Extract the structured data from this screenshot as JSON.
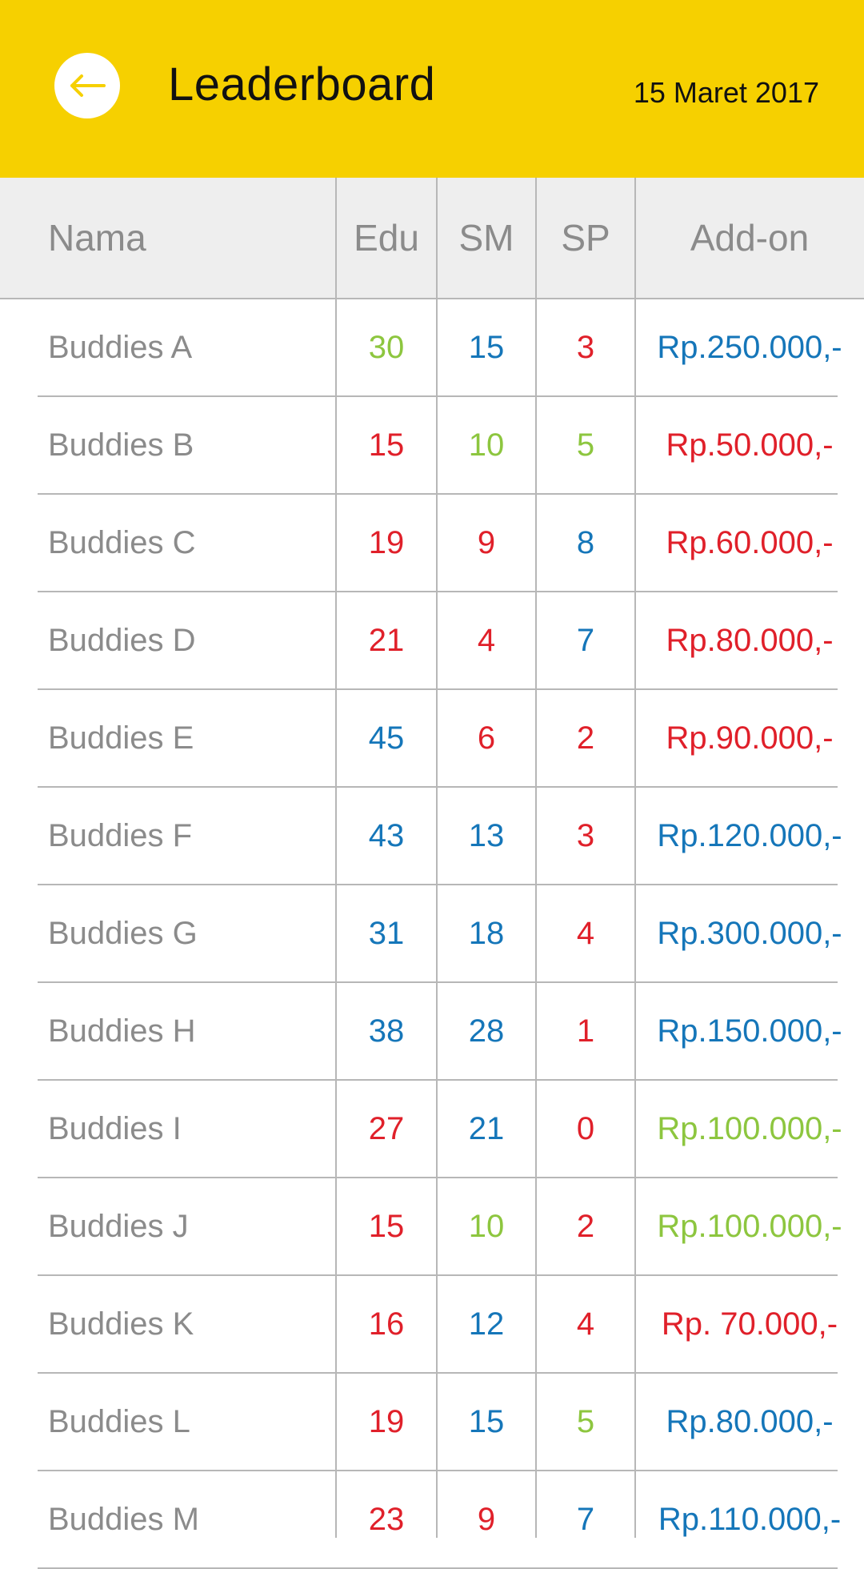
{
  "header": {
    "title": "Leaderboard",
    "date": "15 Maret 2017",
    "back_icon": "arrow-left-icon",
    "background_color": "#f6d000"
  },
  "table": {
    "columns": [
      "Nama",
      "Edu",
      "SM",
      "SP",
      "Add-on"
    ],
    "colors": {
      "green": "#8dc63f",
      "blue": "#1576b9",
      "red": "#e0202a",
      "gray": "#8b8b8b"
    },
    "rows": [
      {
        "name": "Buddies A",
        "edu": "30",
        "edu_color": "green",
        "sm": "15",
        "sm_color": "blue",
        "sp": "3",
        "sp_color": "red",
        "addon": "Rp.250.000,-",
        "addon_color": "blue"
      },
      {
        "name": "Buddies B",
        "edu": "15",
        "edu_color": "red",
        "sm": "10",
        "sm_color": "green",
        "sp": "5",
        "sp_color": "green",
        "addon": "Rp.50.000,-",
        "addon_color": "red"
      },
      {
        "name": "Buddies C",
        "edu": "19",
        "edu_color": "red",
        "sm": "9",
        "sm_color": "red",
        "sp": "8",
        "sp_color": "blue",
        "addon": "Rp.60.000,-",
        "addon_color": "red"
      },
      {
        "name": "Buddies D",
        "edu": "21",
        "edu_color": "red",
        "sm": "4",
        "sm_color": "red",
        "sp": "7",
        "sp_color": "blue",
        "addon": "Rp.80.000,-",
        "addon_color": "red"
      },
      {
        "name": "Buddies E",
        "edu": "45",
        "edu_color": "blue",
        "sm": "6",
        "sm_color": "red",
        "sp": "2",
        "sp_color": "red",
        "addon": "Rp.90.000,-",
        "addon_color": "red"
      },
      {
        "name": "Buddies F",
        "edu": "43",
        "edu_color": "blue",
        "sm": "13",
        "sm_color": "blue",
        "sp": "3",
        "sp_color": "red",
        "addon": "Rp.120.000,-",
        "addon_color": "blue"
      },
      {
        "name": "Buddies G",
        "edu": "31",
        "edu_color": "blue",
        "sm": "18",
        "sm_color": "blue",
        "sp": "4",
        "sp_color": "red",
        "addon": "Rp.300.000,-",
        "addon_color": "blue"
      },
      {
        "name": "Buddies H",
        "edu": "38",
        "edu_color": "blue",
        "sm": "28",
        "sm_color": "blue",
        "sp": "1",
        "sp_color": "red",
        "addon": "Rp.150.000,-",
        "addon_color": "blue"
      },
      {
        "name": "Buddies I",
        "edu": "27",
        "edu_color": "red",
        "sm": "21",
        "sm_color": "blue",
        "sp": "0",
        "sp_color": "red",
        "addon": "Rp.100.000,-",
        "addon_color": "green"
      },
      {
        "name": "Buddies J",
        "edu": "15",
        "edu_color": "red",
        "sm": "10",
        "sm_color": "green",
        "sp": "2",
        "sp_color": "red",
        "addon": "Rp.100.000,-",
        "addon_color": "green"
      },
      {
        "name": "Buddies K",
        "edu": "16",
        "edu_color": "red",
        "sm": "12",
        "sm_color": "blue",
        "sp": "4",
        "sp_color": "red",
        "addon": "Rp. 70.000,-",
        "addon_color": "red"
      },
      {
        "name": "Buddies L",
        "edu": "19",
        "edu_color": "red",
        "sm": "15",
        "sm_color": "blue",
        "sp": "5",
        "sp_color": "green",
        "addon": "Rp.80.000,-",
        "addon_color": "blue"
      },
      {
        "name": "Buddies M",
        "edu": "23",
        "edu_color": "red",
        "sm": "9",
        "sm_color": "red",
        "sp": "7",
        "sp_color": "blue",
        "addon": "Rp.110.000,-",
        "addon_color": "blue"
      }
    ]
  }
}
